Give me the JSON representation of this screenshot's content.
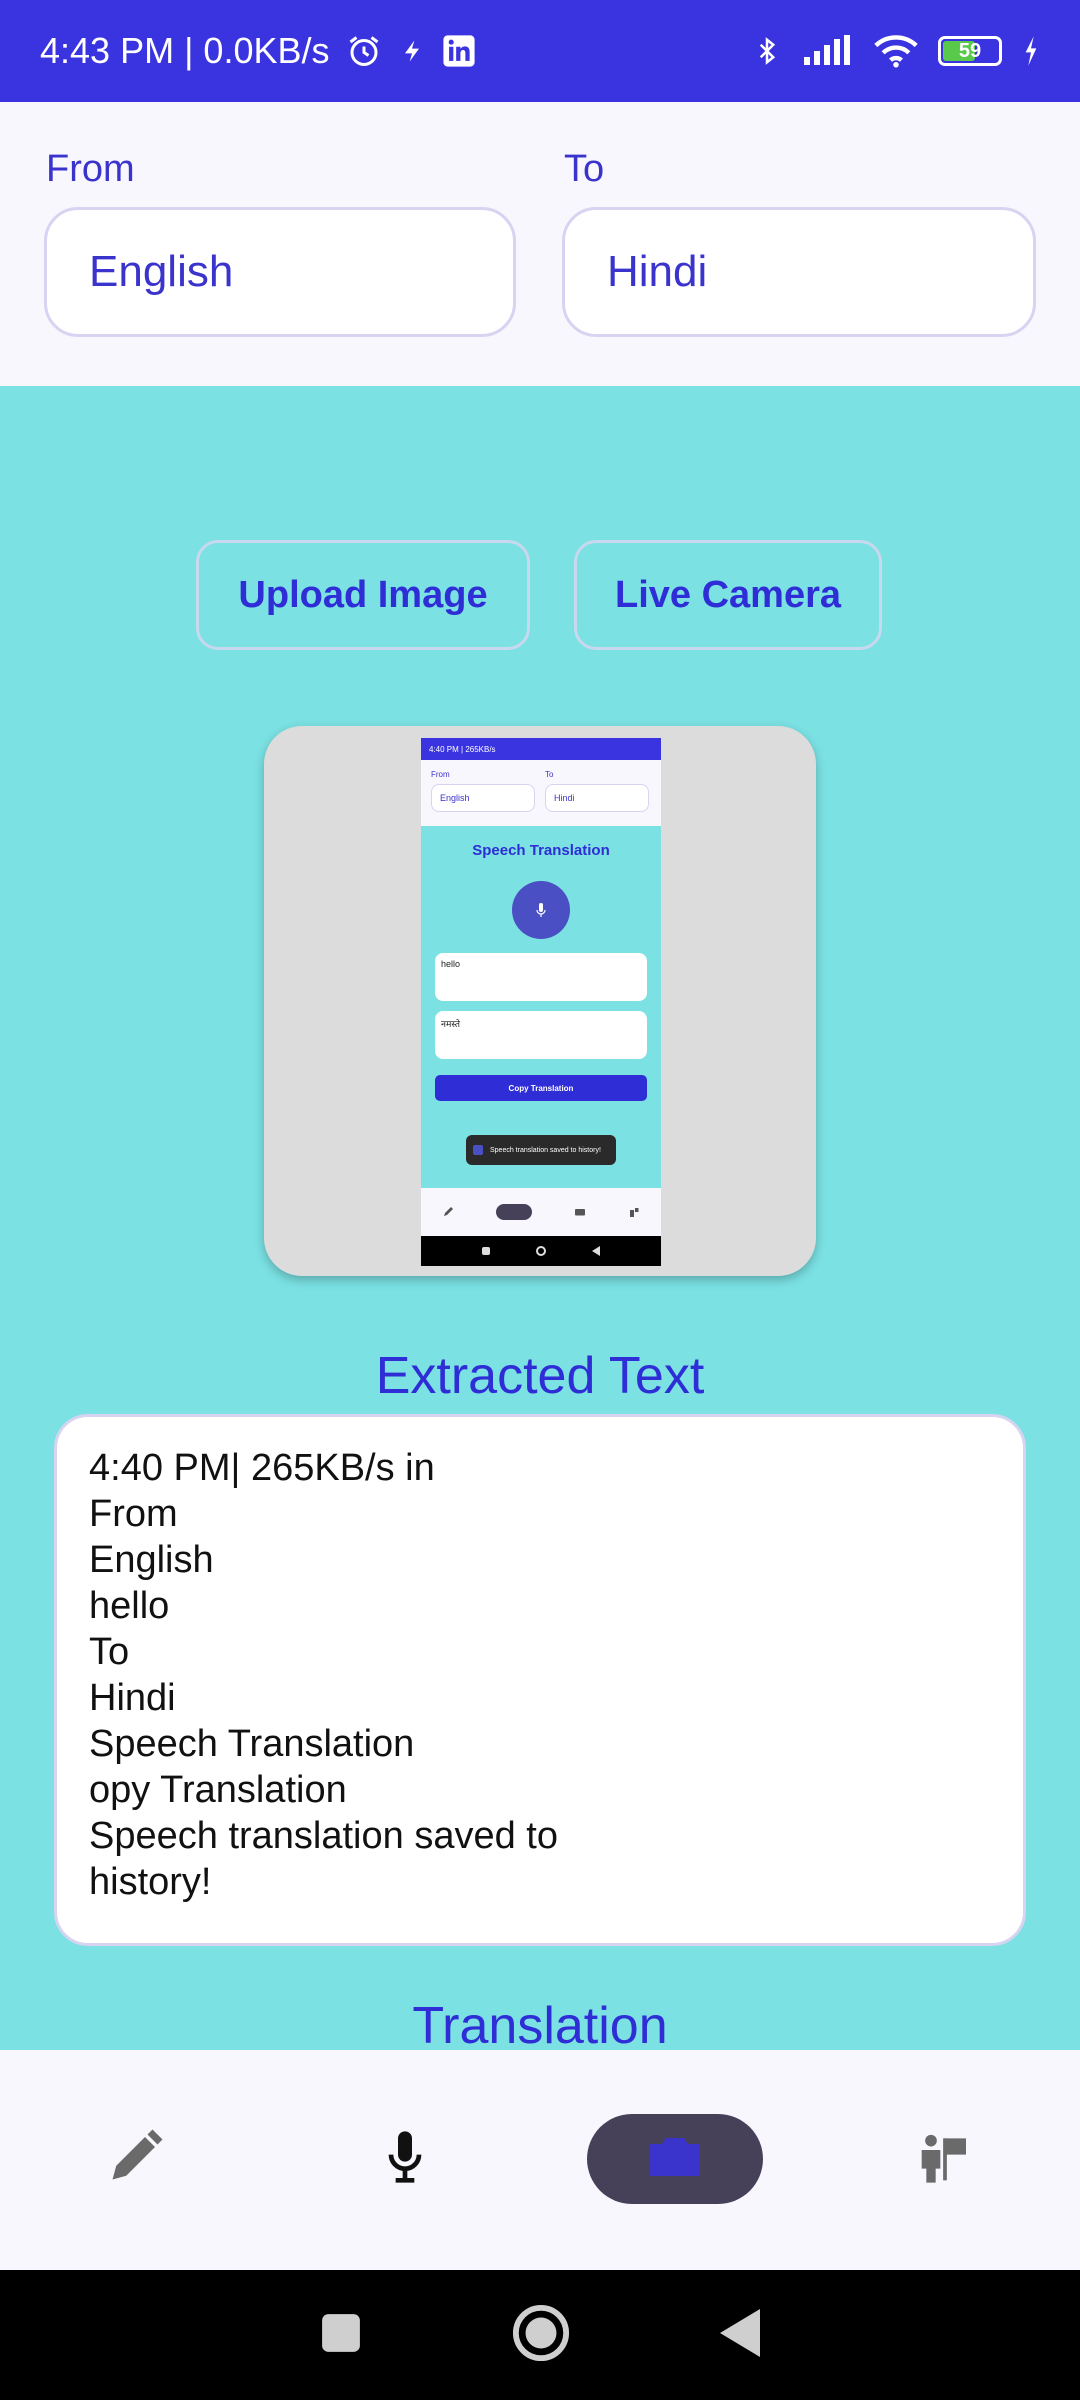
{
  "status_bar": {
    "time_speed": "4:43 PM | 0.0KB/s",
    "battery": "59",
    "icons": [
      "alarm-icon",
      "flash-icon",
      "linkedin-icon",
      "bluetooth-icon",
      "signal-icon",
      "wifi-icon",
      "battery-icon",
      "charging-icon"
    ]
  },
  "languages": {
    "from_label": "From",
    "from_value": "English",
    "to_label": "To",
    "to_value": "Hindi"
  },
  "actions": {
    "upload_label": "Upload Image",
    "camera_label": "Live Camera"
  },
  "preview": {
    "status_text": "4:40 PM | 265KB/s",
    "from_label": "From",
    "from_value": "English",
    "to_label": "To",
    "to_value": "Hindi",
    "title": "Speech Translation",
    "input_text": "hello",
    "output_text": "नमस्ते",
    "copy_label": "Copy Translation",
    "toast_text": "Speech translation saved to history!"
  },
  "extracted": {
    "title": "Extracted Text",
    "lines": [
      "4:40 PM| 265KB/s in",
      "From",
      "English",
      "hello",
      "To",
      "Hindi",
      "Speech Translation",
      "opy Translation",
      "Speech translation saved to",
      "history!"
    ]
  },
  "translation": {
    "title": "Translation"
  },
  "bottom_nav": {
    "items": [
      "pencil-icon",
      "microphone-icon",
      "camera-icon",
      "tour-guide-icon"
    ],
    "active_index": 2
  },
  "colors": {
    "primary": "#3a33e0",
    "accent_text": "#2e2dd6",
    "background": "#7be1e3",
    "header_bg": "#f8f7fd",
    "nav_active": "#474059"
  }
}
